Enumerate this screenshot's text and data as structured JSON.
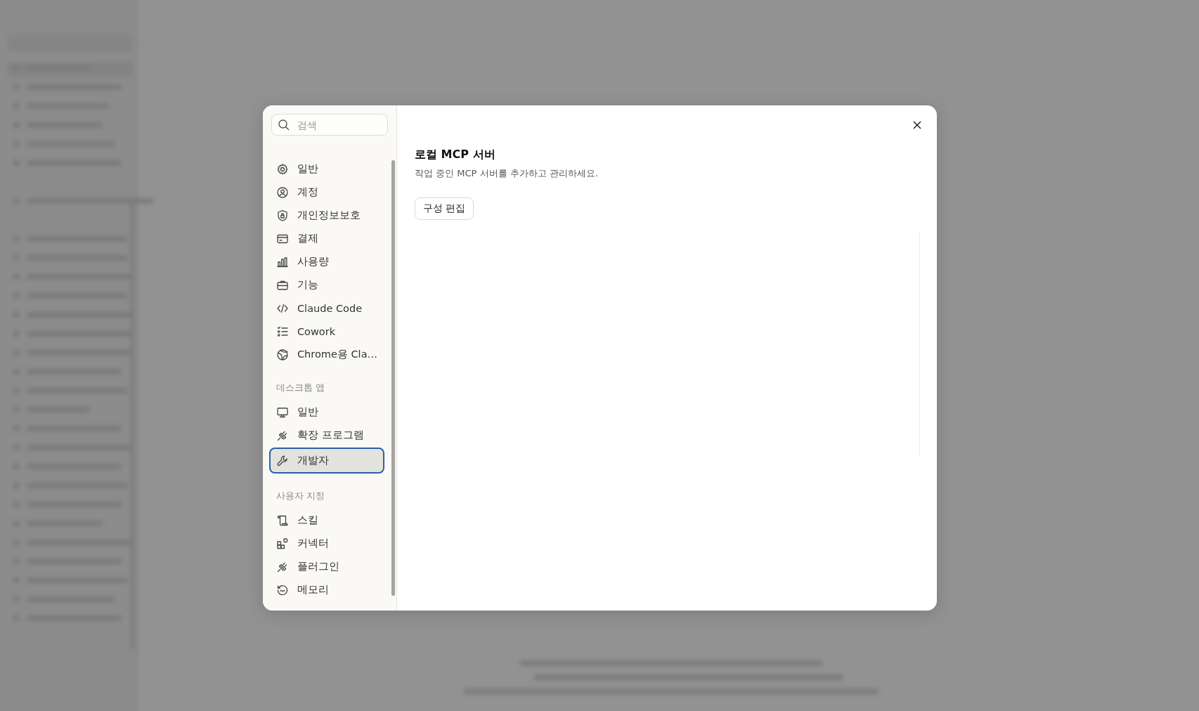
{
  "search": {
    "placeholder": "검색"
  },
  "nav": [
    {
      "items": [
        {
          "label": "일반",
          "selected": false
        },
        {
          "label": "계정",
          "selected": false
        },
        {
          "label": "개인정보보호",
          "selected": false
        },
        {
          "label": "결제",
          "selected": false
        },
        {
          "label": "사용량",
          "selected": false
        },
        {
          "label": "기능",
          "selected": false
        },
        {
          "label": "Claude Code",
          "selected": false
        },
        {
          "label": "Cowork",
          "selected": false
        },
        {
          "label": "Chrome용 Cla…",
          "selected": false
        }
      ]
    },
    {
      "heading": "데스크톱 앱",
      "items": [
        {
          "label": "일반",
          "selected": false
        },
        {
          "label": "확장 프로그램",
          "selected": false
        },
        {
          "label": "개발자",
          "selected": true
        }
      ]
    },
    {
      "heading": "사용자 지정",
      "items": [
        {
          "label": "스킬",
          "selected": false
        },
        {
          "label": "커넥터",
          "selected": false
        },
        {
          "label": "플러그인",
          "selected": false
        },
        {
          "label": "메모리",
          "selected": false
        }
      ]
    }
  ],
  "content": {
    "title": "로컬 MCP 서버",
    "description": "작업 중인 MCP 서버를 추가하고 관리하세요.",
    "button": "구성 편집"
  }
}
